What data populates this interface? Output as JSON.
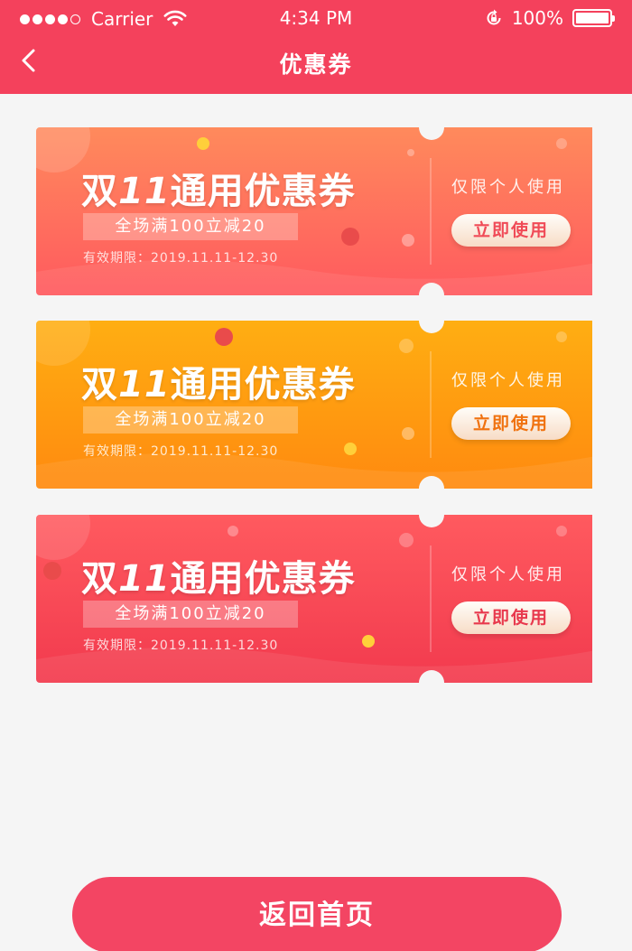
{
  "status_bar": {
    "carrier": "Carrier",
    "time": "4:34 PM",
    "battery": "100%"
  },
  "nav": {
    "title": "优惠券"
  },
  "coupons": [
    {
      "title_prefix": "双",
      "title_number": "11",
      "title_suffix": "通用优惠券",
      "condition": "全场满100立减20",
      "validity": "有效期限：2019.11.11-12.30",
      "limit": "仅限个人使用",
      "button": "立即使用",
      "color_top": "#ff8a5c",
      "color_bottom": "#ff5a5f",
      "button_text_color": "#f04b57"
    },
    {
      "title_prefix": "双",
      "title_number": "11",
      "title_suffix": "通用优惠券",
      "condition": "全场满100立减20",
      "validity": "有效期限：2019.11.11-12.30",
      "limit": "仅限个人使用",
      "button": "立即使用",
      "color_top": "#ffae12",
      "color_bottom": "#ff8a0f",
      "button_text_color": "#f0720f"
    },
    {
      "title_prefix": "双",
      "title_number": "11",
      "title_suffix": "通用优惠券",
      "condition": "全场满100立减20",
      "validity": "有效期限：2019.11.11-12.30",
      "limit": "仅限个人使用",
      "button": "立即使用",
      "color_top": "#ff5a5f",
      "color_bottom": "#f23a4e",
      "button_text_color": "#e8394d"
    }
  ],
  "footer": {
    "home_button": "返回首页"
  },
  "colors": {
    "header": "#f4415c",
    "page_bg": "#f5f5f5"
  }
}
